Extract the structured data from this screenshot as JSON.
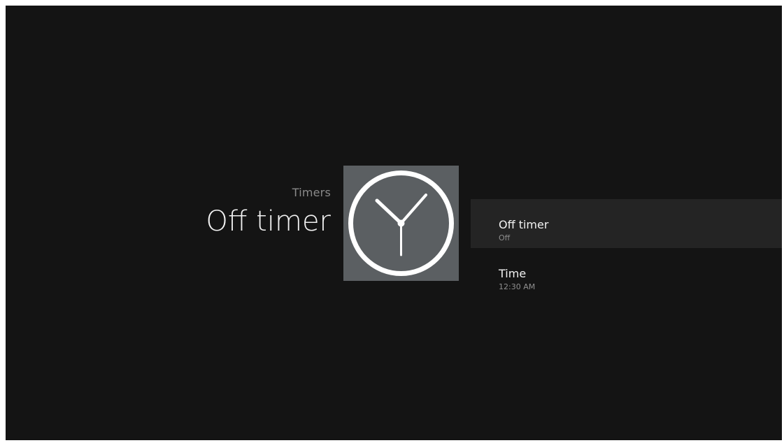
{
  "header": {
    "breadcrumb": "Timers",
    "title": "Off timer"
  },
  "tile": {
    "icon": "clock-icon",
    "background": "#5b5f62"
  },
  "settings": [
    {
      "label": "Off timer",
      "value": "Off",
      "selected": true
    },
    {
      "label": "Time",
      "value": "12:30 AM",
      "selected": false
    }
  ],
  "colors": {
    "background": "#141414",
    "selected_row": "#242424",
    "primary_text": "#f2f2f2",
    "secondary_text": "#8f8f8f"
  }
}
